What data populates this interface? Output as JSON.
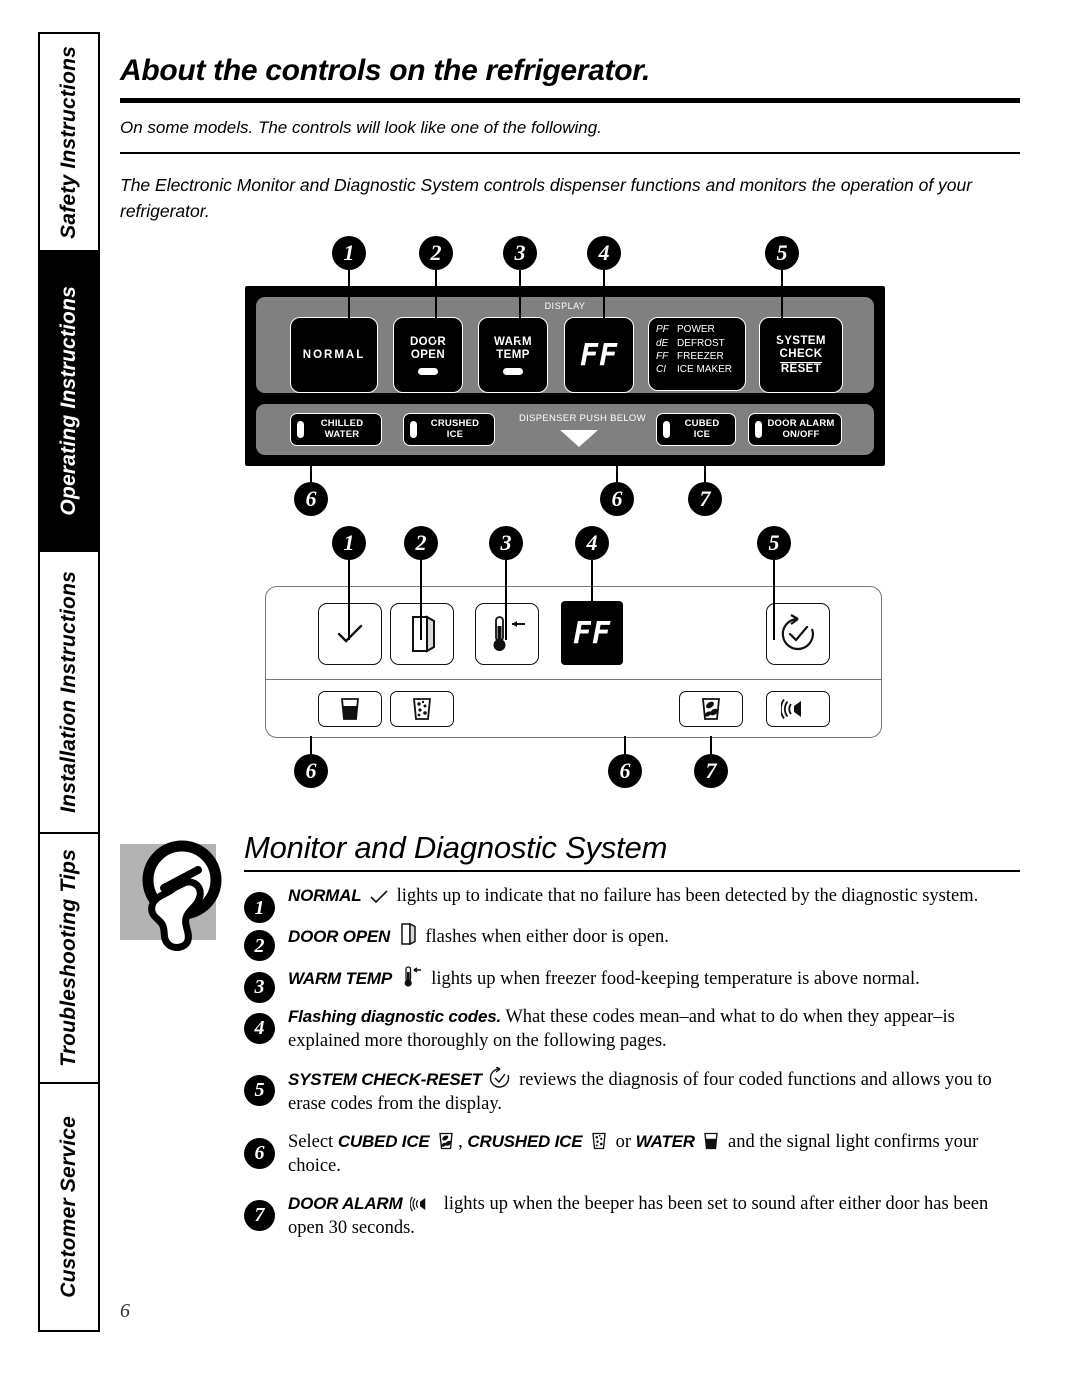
{
  "sidebar": {
    "tabs": [
      {
        "label": "Safety Instructions",
        "active": false
      },
      {
        "label": "Operating Instructions",
        "active": true
      },
      {
        "label": "Installation Instructions",
        "active": false
      },
      {
        "label": "Troubleshooting Tips",
        "active": false
      },
      {
        "label": "Customer Service",
        "active": false
      }
    ]
  },
  "header": {
    "title": "About the controls on the refrigerator.",
    "note": "On some models. The controls will look like one of the following.",
    "intro": "The Electronic Monitor and Diagnostic System controls dispenser functions and monitors the operation of your refrigerator."
  },
  "panel1": {
    "display_label": "DISPLAY",
    "buttons": {
      "normal": "NORMAL",
      "door_open_line1": "DOOR",
      "door_open_line2": "OPEN",
      "warm_temp_line1": "WARM",
      "warm_temp_line2": "TEMP",
      "display_value": "FF",
      "system_check_line1": "SYSTEM",
      "system_check_line2": "CHECK",
      "system_check_line3": "RESET"
    },
    "codes": [
      {
        "code": "PF",
        "name": "POWER"
      },
      {
        "code": "dE",
        "name": "DEFROST"
      },
      {
        "code": "FF",
        "name": "FREEZER"
      },
      {
        "code": "CI",
        "name": "ICE MAKER"
      }
    ],
    "dispenser": {
      "chilled_water_line1": "CHILLED",
      "chilled_water_line2": "WATER",
      "crushed_ice_line1": "CRUSHED",
      "crushed_ice_line2": "ICE",
      "cubed_ice_line1": "CUBED",
      "cubed_ice_line2": "ICE",
      "door_alarm_line1": "DOOR ALARM",
      "door_alarm_line2": "ON/OFF",
      "push_below": "DISPENSER PUSH BELOW"
    },
    "callouts_top": [
      "1",
      "2",
      "3",
      "4",
      "5"
    ],
    "callouts_bottom": [
      "6",
      "6",
      "7"
    ]
  },
  "panel2": {
    "display_value": "FF",
    "callouts_top": [
      "1",
      "2",
      "3",
      "4",
      "5"
    ],
    "callouts_bottom": [
      "6",
      "6",
      "7"
    ],
    "icons": [
      "check-icon",
      "door-open-icon",
      "thermometer-icon",
      "ff-display",
      "system-check-reset-icon",
      "water-glass-icon",
      "crushed-ice-glass-icon",
      "cubed-ice-glass-icon",
      "door-alarm-speaker-icon"
    ]
  },
  "section2": {
    "title": "Monitor and Diagnostic System",
    "items": [
      {
        "num": "1",
        "bold": "NORMAL",
        "icon": "check-icon",
        "text": "lights up to indicate that no failure has been detected by the diagnostic system."
      },
      {
        "num": "2",
        "bold": "DOOR OPEN",
        "icon": "door-open-icon",
        "text": "flashes when either door is open."
      },
      {
        "num": "3",
        "bold": "WARM TEMP",
        "icon": "thermometer-icon",
        "text": "lights up when freezer food-keeping temperature is above normal."
      },
      {
        "num": "4",
        "bold": "Flashing diagnostic codes.",
        "icon": "",
        "text": "What these codes mean–and what to do when they appear–is explained more thoroughly on the following pages."
      },
      {
        "num": "5",
        "bold": "SYSTEM CHECK-RESET",
        "icon": "system-check-reset-icon",
        "text": "reviews the diagnosis of four coded functions and allows you to erase codes from the display."
      },
      {
        "num": "6",
        "bold": "",
        "icon": "",
        "text_pre": "Select",
        "bold1": "CUBED ICE",
        "bold2": "CRUSHED ICE",
        "bold3": "WATER",
        "text_mid": "or",
        "text_post": "and the signal light confirms your choice."
      },
      {
        "num": "7",
        "bold": "DOOR ALARM",
        "icon": "door-alarm-speaker-icon",
        "text": "lights up when the beeper has been set to sound after either door has been open 30 seconds."
      }
    ]
  },
  "footer": {
    "page_number": "6"
  },
  "colors": {
    "panel_bezel": "#000000",
    "panel_face": "#808080",
    "hand_bg": "#b3b3b3",
    "ink": "#000000",
    "paper": "#ffffff"
  }
}
